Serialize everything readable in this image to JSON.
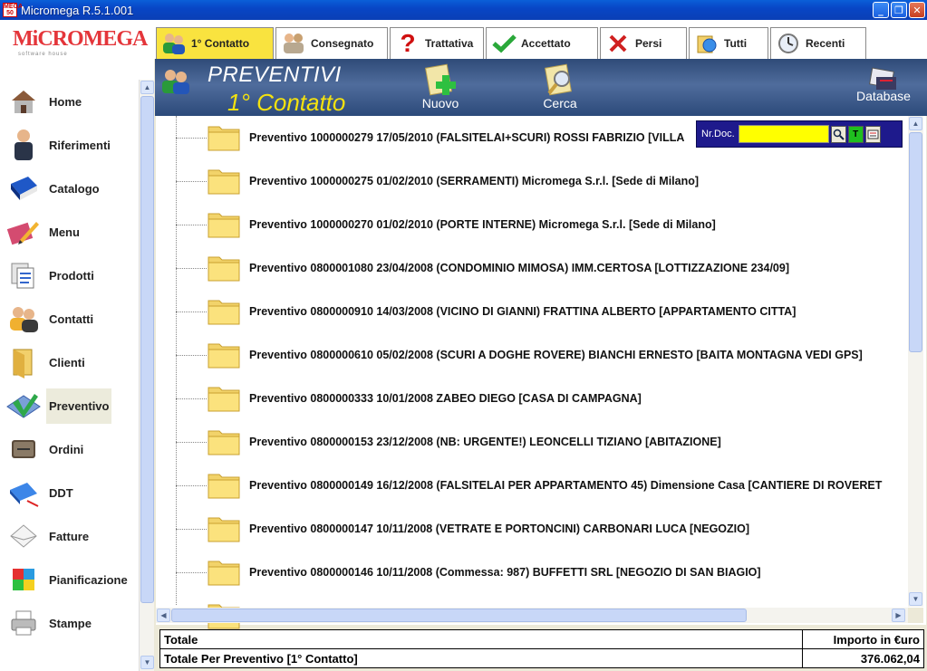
{
  "window": {
    "title": "Micromega R.5.1.001",
    "icon_text": "MEGA 50"
  },
  "window_buttons": [
    "_",
    "❐",
    "✕"
  ],
  "logo": {
    "brand": "MiCROMEGA",
    "tag": "software house"
  },
  "sidebar": {
    "items": [
      {
        "label": "Home",
        "icon": "house-icon"
      },
      {
        "label": "Riferimenti",
        "icon": "person-icon"
      },
      {
        "label": "Catalogo",
        "icon": "book-icon"
      },
      {
        "label": "Menu",
        "icon": "pencil-icon"
      },
      {
        "label": "Prodotti",
        "icon": "documents-icon"
      },
      {
        "label": "Contatti",
        "icon": "contacts-icon"
      },
      {
        "label": "Clienti",
        "icon": "folder-icon"
      },
      {
        "label": "Preventivo",
        "icon": "quote-icon",
        "active": true
      },
      {
        "label": "Ordini",
        "icon": "ledger-icon"
      },
      {
        "label": "DDT",
        "icon": "ddt-icon"
      },
      {
        "label": "Fatture",
        "icon": "envelope-icon"
      },
      {
        "label": "Pianificazione",
        "icon": "cube-icon"
      },
      {
        "label": "Stampe",
        "icon": "printer-icon"
      }
    ]
  },
  "tabs": [
    {
      "label": "1° Contatto",
      "icon": "people-icon",
      "active": true
    },
    {
      "label": "Consegnato",
      "icon": "handshake-icon"
    },
    {
      "label": "Trattativa",
      "icon": "question-icon"
    },
    {
      "label": "Accettato",
      "icon": "check-icon"
    },
    {
      "label": "Persi",
      "icon": "x-icon"
    },
    {
      "label": "Tutti",
      "icon": "all-icon"
    },
    {
      "label": "Recenti",
      "icon": "clock-icon"
    }
  ],
  "banner": {
    "title": "PREVENTIVI",
    "subtitle": "1° Contatto",
    "new_label": "Nuovo",
    "search_label": "Cerca",
    "database_label": "Database"
  },
  "doc_search": {
    "label": "Nr.Doc.",
    "value": "",
    "btn_t": "T"
  },
  "tree": {
    "items": [
      "Preventivo 1000000279 17/05/2010 (FALSITELAI+SCURI) ROSSI FABRIZIO [VILLA",
      "Preventivo 1000000275 01/02/2010 (SERRAMENTI) Micromega S.r.l. [Sede di Milano]",
      "Preventivo 1000000270 01/02/2010 (PORTE INTERNE) Micromega S.r.l. [Sede di Milano]",
      "Preventivo 0800001080 23/04/2008 (CONDOMINIO MIMOSA) IMM.CERTOSA [LOTTIZZAZIONE 234/09]",
      "Preventivo 0800000910 14/03/2008 (VICINO DI GIANNI) FRATTINA ALBERTO [APPARTAMENTO CITTA]",
      "Preventivo 0800000610 05/02/2008 (SCURI A DOGHE ROVERE) BIANCHI ERNESTO [BAITA MONTAGNA VEDI GPS]",
      "Preventivo 0800000333 10/01/2008  ZABEO DIEGO [CASA DI CAMPAGNA]",
      "Preventivo 0800000153 23/12/2008 (NB: URGENTE!) LEONCELLI TIZIANO [ABITAZIONE]",
      "Preventivo 0800000149 16/12/2008 (FALSITELAI PER APPARTAMENTO 45) Dimensione Casa [CANTIERE DI ROVERET",
      "Preventivo 0800000147 10/11/2008 (VETRATE E PORTONCINI) CARBONARI LUCA [NEGOZIO]",
      "Preventivo 0800000146 10/11/2008 (Commessa: 987) BUFFETTI SRL [NEGOZIO DI SAN BIAGIO]",
      ""
    ]
  },
  "totals": {
    "header_left": "Totale",
    "header_right": "Importo in €uro",
    "row_left": "Totale Per Preventivo  [1° Contatto]",
    "row_right": "376.062,04"
  }
}
